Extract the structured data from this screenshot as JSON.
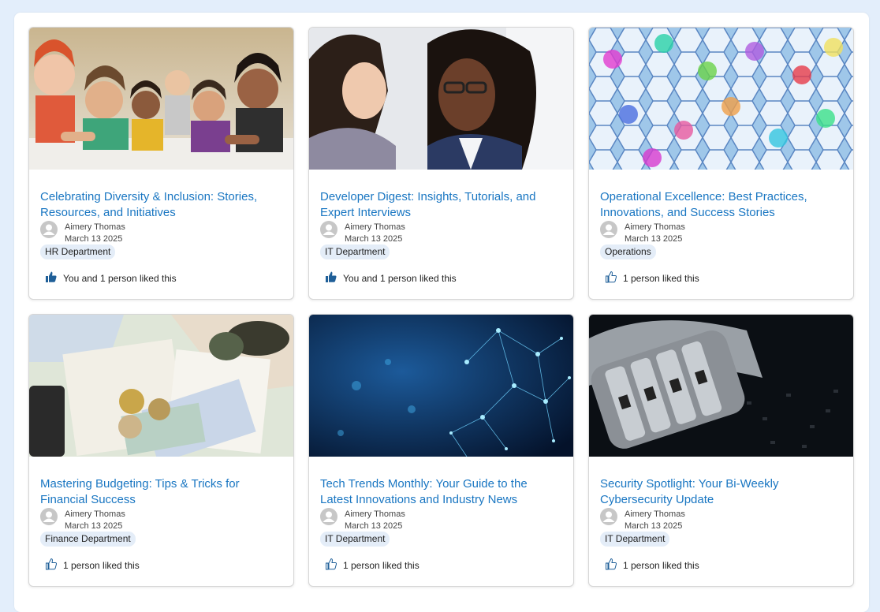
{
  "posts": [
    {
      "title": "Celebrating Diversity & Inclusion: Stories, Resources, and Initiatives",
      "author": "Aimery Thomas",
      "date": "March 13 2025",
      "tag": "HR Department",
      "likes": "You and 1 person liked this",
      "liked": true,
      "image": "team-photo"
    },
    {
      "title": "Developer Digest: Insights, Tutorials, and Expert Interviews",
      "author": "Aimery Thomas",
      "date": "March 13 2025",
      "tag": "IT Department",
      "likes": "You and 1 person liked this",
      "liked": true,
      "image": "developers-photo"
    },
    {
      "title": "Operational Excellence: Best Practices, Innovations, and Success Stories",
      "author": "Aimery Thomas",
      "date": "March 13 2025",
      "tag": "Operations",
      "likes": "1 person liked this",
      "liked": false,
      "image": "hexagons"
    },
    {
      "title": "Mastering Budgeting: Tips & Tricks for Financial Success",
      "author": "Aimery Thomas",
      "date": "March 13 2025",
      "tag": "Finance Department",
      "likes": "1 person liked this",
      "liked": false,
      "image": "money-map"
    },
    {
      "title": "Tech Trends Monthly: Your Guide to the Latest Innovations and Industry News",
      "author": "Aimery Thomas",
      "date": "March 13 2025",
      "tag": "IT Department",
      "likes": "1 person liked this",
      "liked": false,
      "image": "network"
    },
    {
      "title": "Security Spotlight: Your Bi-Weekly Cybersecurity Update",
      "author": "Aimery Thomas",
      "date": "March 13 2025",
      "tag": "IT Department",
      "likes": "1 person liked this",
      "liked": false,
      "image": "padlock"
    }
  ],
  "colors": {
    "link": "#1976c2",
    "tag_bg": "#e4edf8",
    "liked_icon": "#1f5f98",
    "background": "#e3eefb"
  }
}
